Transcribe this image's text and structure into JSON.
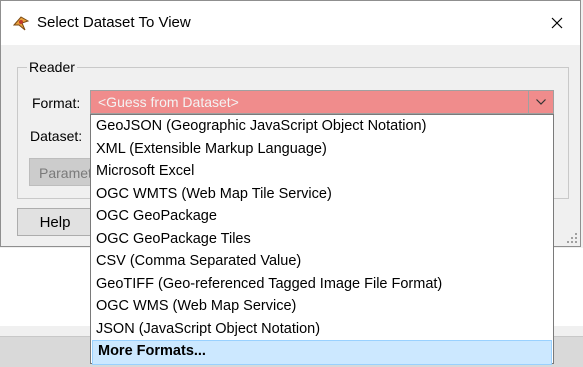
{
  "window": {
    "title": "Select Dataset To View"
  },
  "reader": {
    "group_label": "Reader",
    "format_label": "Format:",
    "format_value": "<Guess from Dataset>",
    "dataset_label": "Dataset:",
    "parameters_label": "Parameters...",
    "help_label": "Help"
  },
  "dropdown": {
    "items": [
      "GeoJSON (Geographic JavaScript Object Notation)",
      "XML (Extensible Markup Language)",
      "Microsoft Excel",
      "OGC WMTS (Web Map Tile Service)",
      "OGC GeoPackage",
      "OGC GeoPackage Tiles",
      "CSV (Comma Separated Value)",
      "GeoTIFF (Geo-referenced Tagged Image File Format)",
      "OGC WMS (Web Map Service)",
      "JSON (JavaScript Object Notation)"
    ],
    "more_label": "More Formats..."
  },
  "colors": {
    "invalid_field": "#f08c8c",
    "selected_item": "#cce8ff"
  }
}
